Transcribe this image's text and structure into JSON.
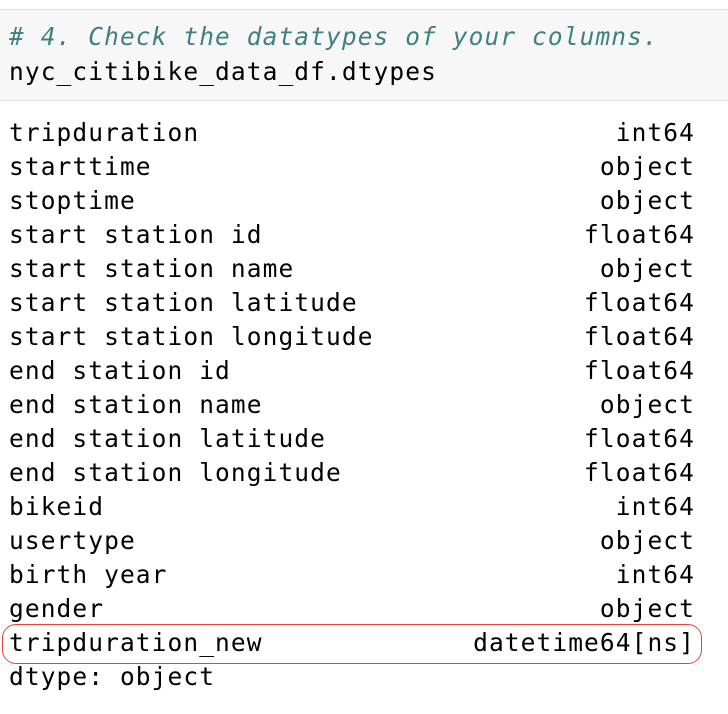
{
  "input_cell": {
    "comment": "# 4. Check the datatypes of your columns.",
    "code": "nyc_citibike_data_df.dtypes"
  },
  "output": {
    "rows": [
      {
        "name": "tripduration",
        "dtype": "int64"
      },
      {
        "name": "starttime",
        "dtype": "object"
      },
      {
        "name": "stoptime",
        "dtype": "object"
      },
      {
        "name": "start station id",
        "dtype": "float64"
      },
      {
        "name": "start station name",
        "dtype": "object"
      },
      {
        "name": "start station latitude",
        "dtype": "float64"
      },
      {
        "name": "start station longitude",
        "dtype": "float64"
      },
      {
        "name": "end station id",
        "dtype": "float64"
      },
      {
        "name": "end station name",
        "dtype": "object"
      },
      {
        "name": "end station latitude",
        "dtype": "float64"
      },
      {
        "name": "end station longitude",
        "dtype": "float64"
      },
      {
        "name": "bikeid",
        "dtype": "int64"
      },
      {
        "name": "usertype",
        "dtype": "object"
      },
      {
        "name": "birth year",
        "dtype": "int64"
      },
      {
        "name": "gender",
        "dtype": "object"
      },
      {
        "name": "tripduration_new",
        "dtype": "datetime64[ns]"
      }
    ],
    "footer": "dtype: object"
  },
  "colors": {
    "comment": "#408080",
    "input_background": "#f7f7f7",
    "highlight_outline": "#e8423a"
  }
}
